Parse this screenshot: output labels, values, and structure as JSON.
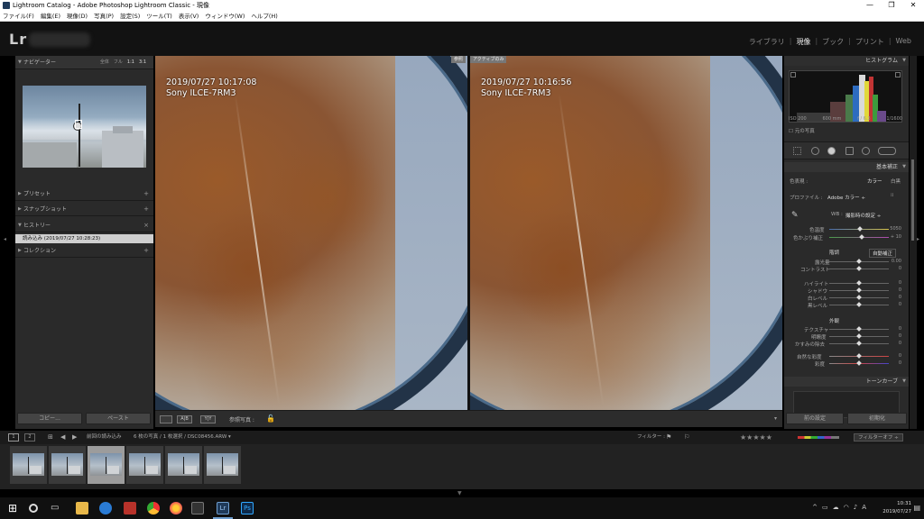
{
  "window": {
    "title": "Lightroom Catalog - Adobe Photoshop Lightroom Classic - 現像",
    "controls": [
      "—",
      "❐",
      "✕"
    ]
  },
  "menu": [
    "ファイル(F)",
    "編集(E)",
    "現像(D)",
    "写真(P)",
    "設定(S)",
    "ツール(T)",
    "表示(V)",
    "ウィンドウ(W)",
    "ヘルプ(H)"
  ],
  "header": {
    "logo": "Lr",
    "modules": [
      "ライブラリ",
      "現像",
      "ブック",
      "プリント",
      "Web"
    ],
    "active_module": "現像"
  },
  "left": {
    "navigator": "ナビゲーター",
    "nav_opts": [
      "全体",
      "フル",
      "1:1",
      "3:1"
    ],
    "presets": "プリセット",
    "snapshots": "スナップショット",
    "history": "ヒストリー",
    "history_item": "読み込み (2019/07/27 10:28:23)",
    "collections": "コレクション",
    "copy": "コピー...",
    "paste": "ペースト",
    "plus": "+",
    "close": "×"
  },
  "center": {
    "left_tag": "参照",
    "right_tag": "アクティブのみ",
    "left_date": "2019/07/27 10:17:08",
    "left_cam": "Sony ILCE-7RM3",
    "right_date": "2019/07/27 10:16:56",
    "right_cam": "Sony ILCE-7RM3",
    "ref_label": "参照写真 :",
    "toolbar_opts": [
      "A|B",
      "Y|Y"
    ]
  },
  "right": {
    "histogram": "ヒストグラム",
    "iso": "ISO 200",
    "focal": "600 mm",
    "aperture": "f / 6.3",
    "shutter": "1/1600",
    "original": "元の写真",
    "basic": "基本補正",
    "treatment": "色表現 :",
    "color": "カラー",
    "bw": "白黒",
    "profile_label": "プロファイル :",
    "profile": "Adobe カラー ÷",
    "wb_label": "WB :",
    "wb_value": "撮影時の設定 ÷",
    "temp": "色温度",
    "temp_val": "5050",
    "tint": "色かぶり補正",
    "tint_val": "+ 10",
    "tone": "階調",
    "auto": "自動補正",
    "exposure": "露光量",
    "exposure_val": "0.00",
    "contrast": "コントラスト",
    "highlights": "ハイライト",
    "shadows": "シャドウ",
    "whites": "白レベル",
    "blacks": "黒レベル",
    "presence": "外観",
    "texture": "テクスチャ",
    "clarity": "明瞭度",
    "dehaze": "かすみの除去",
    "vibrance": "自然な彩度",
    "saturation": "彩度",
    "zero": "0",
    "tonecurve": "トーンカーブ",
    "previous": "前の設定",
    "reset": "初期化"
  },
  "film": {
    "pages": [
      "1",
      "2"
    ],
    "source": "前回の読み込み",
    "count": "6 枚の写真 / 1 枚選択 / DSC08456.ARW ▾",
    "filter": "フィルター :",
    "stars": "★★★★★",
    "filter_off": "フィルターオフ ÷"
  },
  "taskbar": {
    "time": "10:31",
    "date": "2019/07/27",
    "ime": "A"
  },
  "colors": {
    "panel": "#2a2a2a",
    "rust": "#9a5a2a",
    "rim": "#223347"
  }
}
